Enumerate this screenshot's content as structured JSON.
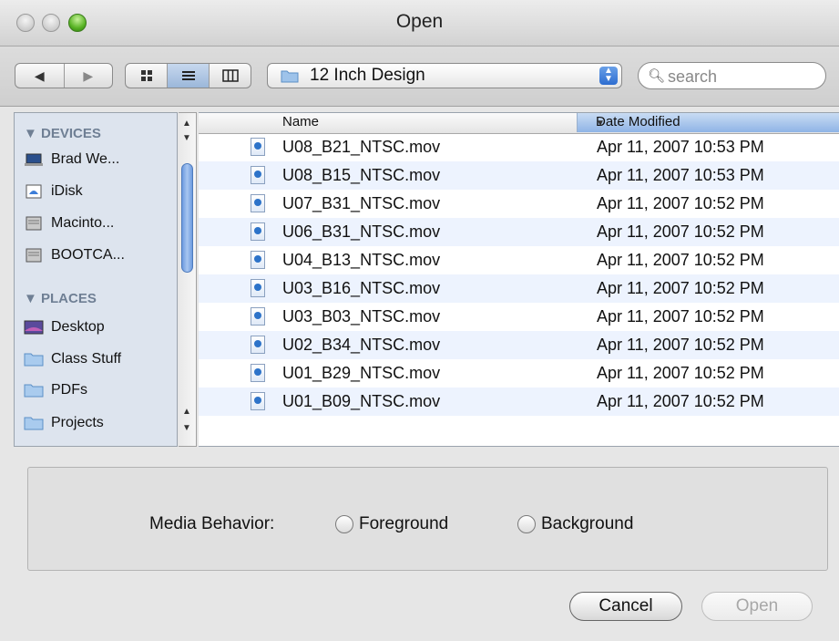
{
  "window": {
    "title": "Open"
  },
  "toolbar": {
    "back_glyph": "◀",
    "forward_glyph": "▶",
    "view_icons": [
      "icon-view-icon",
      "list-view-icon",
      "column-view-icon"
    ],
    "location": "12 Inch Design",
    "search_placeholder": "search"
  },
  "sidebar": {
    "devices_header": "▼ DEVICES",
    "places_header": "▼ PLACES",
    "devices": [
      {
        "label": "Brad We...",
        "icon": "laptop-icon"
      },
      {
        "label": "iDisk",
        "icon": "idisk-icon"
      },
      {
        "label": "Macinto...",
        "icon": "hard-drive-icon"
      },
      {
        "label": "BOOTCA...",
        "icon": "hard-drive-icon"
      }
    ],
    "places": [
      {
        "label": "Desktop",
        "icon": "desktop-icon"
      },
      {
        "label": "Class Stuff",
        "icon": "folder-icon"
      },
      {
        "label": "PDFs",
        "icon": "folder-icon"
      },
      {
        "label": "Projects",
        "icon": "folder-icon"
      }
    ]
  },
  "filelist": {
    "columns": {
      "name": "Name",
      "date": "Date Modified"
    },
    "rows": [
      {
        "name": "U08_B21_NTSC.mov",
        "date": "Apr 11, 2007 10:53 PM"
      },
      {
        "name": "U08_B15_NTSC.mov",
        "date": "Apr 11, 2007 10:53 PM"
      },
      {
        "name": "U07_B31_NTSC.mov",
        "date": "Apr 11, 2007 10:52 PM"
      },
      {
        "name": "U06_B31_NTSC.mov",
        "date": "Apr 11, 2007 10:52 PM"
      },
      {
        "name": "U04_B13_NTSC.mov",
        "date": "Apr 11, 2007 10:52 PM"
      },
      {
        "name": "U03_B16_NTSC.mov",
        "date": "Apr 11, 2007 10:52 PM"
      },
      {
        "name": "U03_B03_NTSC.mov",
        "date": "Apr 11, 2007 10:52 PM"
      },
      {
        "name": "U02_B34_NTSC.mov",
        "date": "Apr 11, 2007 10:52 PM"
      },
      {
        "name": "U01_B29_NTSC.mov",
        "date": "Apr 11, 2007 10:52 PM"
      },
      {
        "name": "U01_B09_NTSC.mov",
        "date": "Apr 11, 2007 10:52 PM"
      }
    ]
  },
  "options": {
    "media_behavior_label": "Media Behavior:",
    "foreground_label": "Foreground",
    "background_label": "Background"
  },
  "buttons": {
    "cancel": "Cancel",
    "open": "Open"
  },
  "colors": {
    "selection_blue": "#8fb4e6",
    "row_alt": "#edf3fe",
    "accent": "#2d6dd0"
  }
}
